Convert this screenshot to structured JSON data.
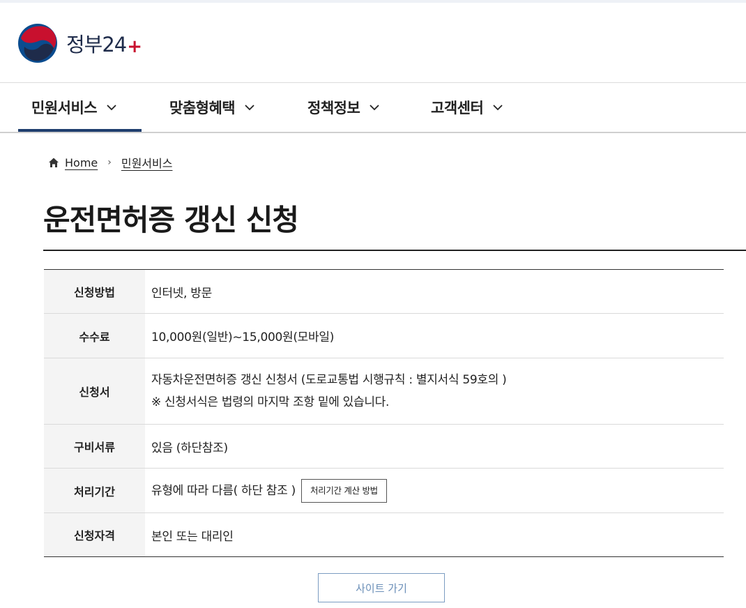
{
  "header": {
    "logo_text": "정부24",
    "logo_plus": "+",
    "colors": {
      "brand_navy": "#1e2b4a",
      "brand_red": "#c8102e",
      "brand_blue": "#0a4c8f",
      "active_underline": "#1f3e6e"
    }
  },
  "nav": {
    "items": [
      {
        "label": "민원서비스",
        "active": true
      },
      {
        "label": "맞춤형혜택",
        "active": false
      },
      {
        "label": "정책정보",
        "active": false
      },
      {
        "label": "고객센터",
        "active": false
      }
    ]
  },
  "breadcrumb": {
    "home_label": "Home",
    "current_label": "민원서비스",
    "home_icon": "home-icon"
  },
  "page": {
    "title": "운전면허증 갱신 신청"
  },
  "info_table": {
    "rows": [
      {
        "label": "신청방법",
        "value": "인터넷, 방문"
      },
      {
        "label": "수수료",
        "value": "10,000원(일반)~15,000원(모바일)"
      },
      {
        "label": "신청서",
        "value": "자동차운전면허증 갱신 신청서 (도로교통법 시행규칙 : 별지서식 59호의 )",
        "note": "※ 신청서식은 법령의 마지막 조항 밑에 있습니다."
      },
      {
        "label": "구비서류",
        "value": "있음 (하단참조)"
      },
      {
        "label": "처리기간",
        "value": "유형에 따라 다름( 하단 참조 )",
        "button": "처리기간 계산 방법"
      },
      {
        "label": "신청자격",
        "value": "본인 또는 대리인"
      }
    ]
  },
  "actions": {
    "site_button": "사이트 가기"
  }
}
